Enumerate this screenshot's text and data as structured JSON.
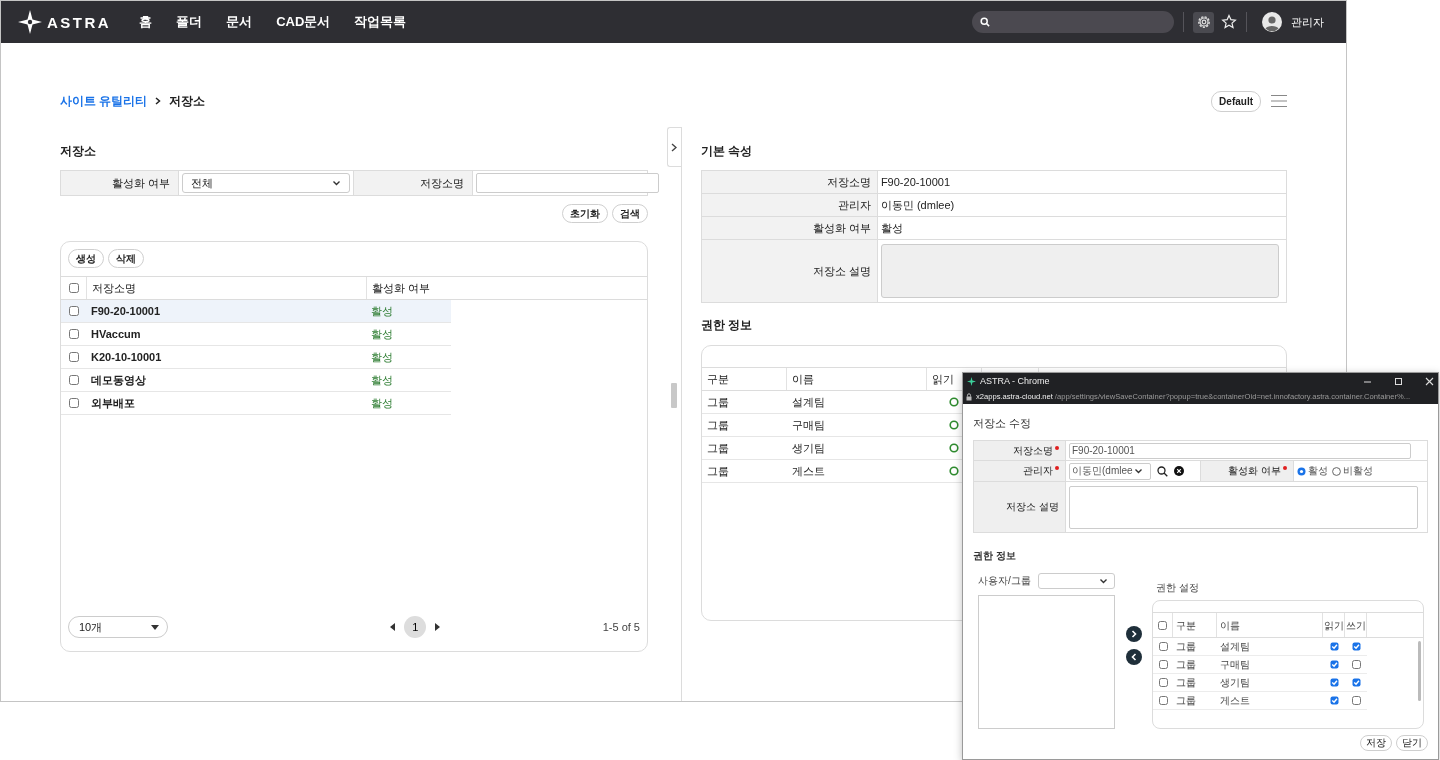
{
  "nav": {
    "logo": "ASTRA",
    "menu": [
      {
        "label": "홈"
      },
      {
        "label": "폴더"
      },
      {
        "label": "문서"
      },
      {
        "label": "CAD문서"
      },
      {
        "label": "작업목록"
      }
    ],
    "user": "관리자"
  },
  "breadcrumb": [
    {
      "label": "사이트 유틸리티",
      "kind": "link"
    },
    {
      "label": "저장소",
      "kind": "current"
    }
  ],
  "view_button": "Default",
  "storage": {
    "title": "저장소",
    "filters": [
      {
        "label": "활성화 여부",
        "kind": "select",
        "value": "전체"
      },
      {
        "label": "저장소명",
        "kind": "text"
      }
    ],
    "buttons": [
      "초기화",
      "검색"
    ],
    "grid": {
      "actions": [
        "생성",
        "삭제"
      ],
      "select_all": false,
      "columns": [
        "저장소명",
        "활성화 여부"
      ],
      "rows": [
        {
          "name": "F90-20-10001",
          "status": "활성",
          "checked": false,
          "selected": true
        },
        {
          "name": "HVaccum",
          "status": "활성",
          "checked": false,
          "selected": false
        },
        {
          "name": "K20-10-10001",
          "status": "활성",
          "checked": false,
          "selected": false
        },
        {
          "name": "데모동영상",
          "status": "활성",
          "checked": false,
          "selected": false
        },
        {
          "name": "외부배포",
          "status": "활성",
          "checked": false,
          "selected": false
        }
      ],
      "page_size": "10개",
      "pages": [
        {
          "label": "1",
          "selected": true
        }
      ],
      "range": "1-5 of 5"
    }
  },
  "details": {
    "title": "기본 속성",
    "fields": [
      {
        "label": "저장소명",
        "kind": "text",
        "value": "F90-20-10001"
      },
      {
        "label": "관리자",
        "kind": "text",
        "value": "이동민 (dmlee)"
      },
      {
        "label": "활성화 여부",
        "kind": "text",
        "value": "활성"
      },
      {
        "label": "저장소 설명",
        "kind": "textarea"
      }
    ]
  },
  "permissions": {
    "title": "권한 정보",
    "columns": [
      "구분",
      "이름",
      "읽기"
    ],
    "rows": [
      {
        "type": "그룹",
        "name": "설계팀",
        "read": true
      },
      {
        "type": "그룹",
        "name": "구매팀",
        "read": true
      },
      {
        "type": "그룹",
        "name": "생기팀",
        "read": true
      },
      {
        "type": "그룹",
        "name": "게스트",
        "read": true
      }
    ]
  },
  "popup": {
    "window_title": "ASTRA - Chrome",
    "url_host": "x2apps.astra-cloud.net",
    "url_path": "/app/settings/viewSaveContainer?popup=true&containerOid=net.innofactory.astra.container.Container%...",
    "title": "저장소 수정",
    "form": {
      "name": {
        "label": "저장소명",
        "required": true,
        "value": "F90-20-10001"
      },
      "manager": {
        "label": "관리자",
        "required": true,
        "value": "이동민(dmlee"
      },
      "active": {
        "label": "활성화 여부",
        "required": true,
        "options": [
          {
            "label": "활성",
            "selected": true
          },
          {
            "label": "비활성",
            "selected": false
          }
        ]
      },
      "description": {
        "label": "저장소 설명"
      }
    },
    "perm_title": "권한 정보",
    "picker_label": "사용자/그룹",
    "settings_title": "권한 설정",
    "select_all": false,
    "columns": [
      "구분",
      "이름",
      "읽기",
      "쓰기"
    ],
    "rows": [
      {
        "type": "그룹",
        "name": "설계팀",
        "checked": false,
        "read": true,
        "write": true
      },
      {
        "type": "그룹",
        "name": "구매팀",
        "checked": false,
        "read": true,
        "write": false
      },
      {
        "type": "그룹",
        "name": "생기팀",
        "checked": false,
        "read": true,
        "write": true
      },
      {
        "type": "그룹",
        "name": "게스트",
        "checked": false,
        "read": true,
        "write": false
      }
    ],
    "buttons": [
      "저장",
      "닫기"
    ]
  }
}
